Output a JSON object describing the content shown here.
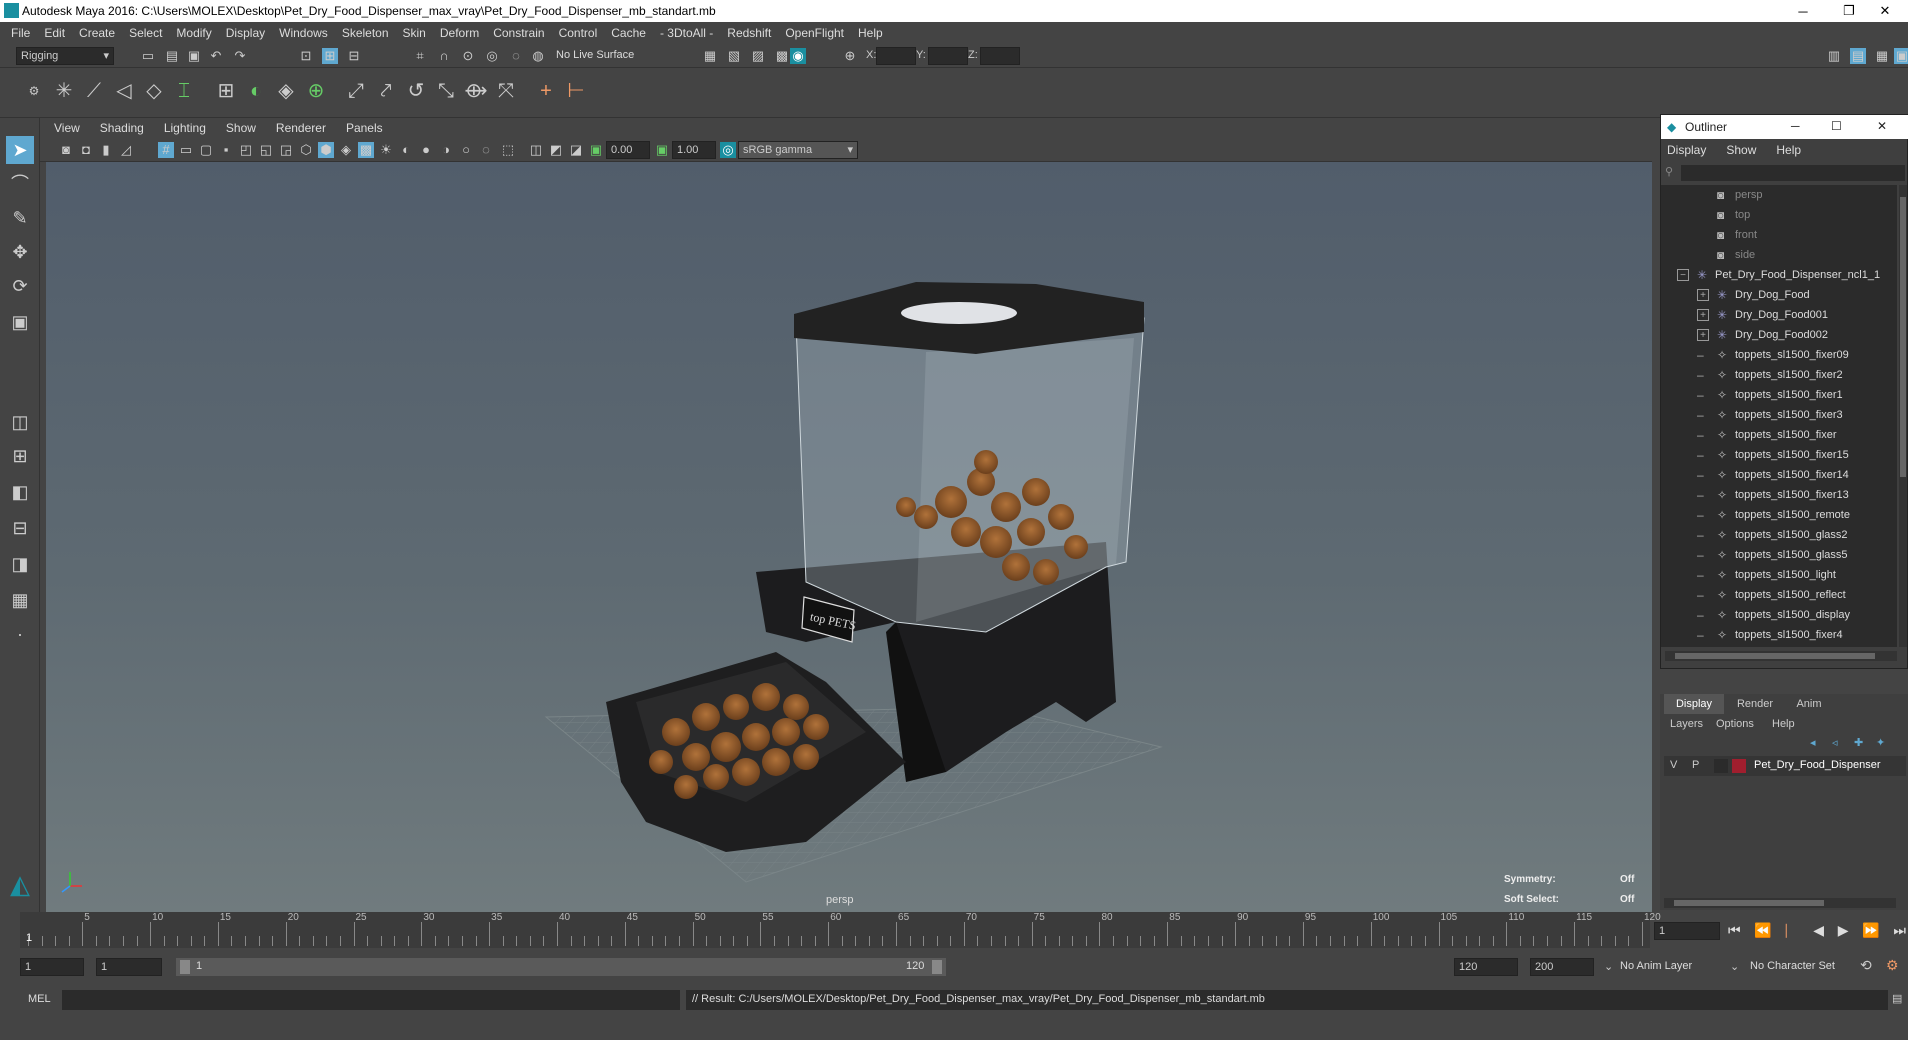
{
  "window": {
    "title": "Autodesk Maya 2016: C:\\Users\\MOLEX\\Desktop\\Pet_Dry_Food_Dispenser_max_vray\\Pet_Dry_Food_Dispenser_mb_standart.mb",
    "min": "─",
    "restore": "❐",
    "close": "✕"
  },
  "menubar": [
    "File",
    "Edit",
    "Create",
    "Select",
    "Modify",
    "Display",
    "Windows",
    "Skeleton",
    "Skin",
    "Deform",
    "Constrain",
    "Control",
    "Cache",
    "- 3DtoAll -",
    "Redshift",
    "OpenFlight",
    "Help"
  ],
  "toolbar": {
    "mode": "Rigging",
    "live_surface": "No Live Surface",
    "x_label": "X:",
    "y_label": "Y:",
    "z_label": "Z:"
  },
  "panel_menu": [
    "View",
    "Shading",
    "Lighting",
    "Show",
    "Renderer",
    "Panels"
  ],
  "viewbar": {
    "exposure": "0.00",
    "gamma": "1.00",
    "colorspace": "sRGB gamma"
  },
  "viewport": {
    "camera": "persp",
    "symmetry_label": "Symmetry:",
    "symmetry_value": "Off",
    "softselect_label": "Soft Select:",
    "softselect_value": "Off",
    "brand_text": "top PETS"
  },
  "outliner": {
    "title": "Outliner",
    "menu": [
      "Display",
      "Show",
      "Help"
    ],
    "items": [
      {
        "label": "persp",
        "type": "camera",
        "dim": true
      },
      {
        "label": "top",
        "type": "camera",
        "dim": true
      },
      {
        "label": "front",
        "type": "camera",
        "dim": true
      },
      {
        "label": "side",
        "type": "camera",
        "dim": true
      },
      {
        "label": "Pet_Dry_Food_Dispenser_ncl1_1",
        "type": "group",
        "expand": "−"
      },
      {
        "label": "Dry_Dog_Food",
        "type": "group",
        "expand": "+"
      },
      {
        "label": "Dry_Dog_Food001",
        "type": "group",
        "expand": "+"
      },
      {
        "label": "Dry_Dog_Food002",
        "type": "group",
        "expand": "+"
      },
      {
        "label": "toppets_sl1500_fixer09",
        "type": "mesh"
      },
      {
        "label": "toppets_sl1500_fixer2",
        "type": "mesh"
      },
      {
        "label": "toppets_sl1500_fixer1",
        "type": "mesh"
      },
      {
        "label": "toppets_sl1500_fixer3",
        "type": "mesh"
      },
      {
        "label": "toppets_sl1500_fixer",
        "type": "mesh"
      },
      {
        "label": "toppets_sl1500_fixer15",
        "type": "mesh"
      },
      {
        "label": "toppets_sl1500_fixer14",
        "type": "mesh"
      },
      {
        "label": "toppets_sl1500_fixer13",
        "type": "mesh"
      },
      {
        "label": "toppets_sl1500_remote",
        "type": "mesh"
      },
      {
        "label": "toppets_sl1500_glass2",
        "type": "mesh"
      },
      {
        "label": "toppets_sl1500_glass5",
        "type": "mesh"
      },
      {
        "label": "toppets_sl1500_light",
        "type": "mesh"
      },
      {
        "label": "toppets_sl1500_reflect",
        "type": "mesh"
      },
      {
        "label": "toppets_sl1500_display",
        "type": "mesh"
      },
      {
        "label": "toppets_sl1500_fixer4",
        "type": "mesh"
      }
    ]
  },
  "layers": {
    "tabs": [
      "Display",
      "Render",
      "Anim"
    ],
    "menu": [
      "Layers",
      "Options",
      "Help"
    ],
    "row": {
      "v": "V",
      "p": "P",
      "name": "Pet_Dry_Food_Dispenser",
      "color": "#a01e2e"
    }
  },
  "timeline": {
    "ticks": [
      "5",
      "10",
      "15",
      "20",
      "25",
      "30",
      "35",
      "40",
      "45",
      "50",
      "55",
      "60",
      "65",
      "70",
      "75",
      "80",
      "85",
      "90",
      "95",
      "100",
      "105",
      "110",
      "115",
      "120"
    ],
    "start_marker": "1",
    "current_frame": "1"
  },
  "range": {
    "start": "1",
    "playback_start": "1",
    "slider_start": "1",
    "slider_end": "120",
    "playback_end": "120",
    "end": "200",
    "anim_layer": "No Anim Layer",
    "char_set": "No Character Set"
  },
  "cmdline": {
    "lang": "MEL",
    "result": "// Result: C:/Users/MOLEX/Desktop/Pet_Dry_Food_Dispenser_max_vray/Pet_Dry_Food_Dispenser_mb_standart.mb"
  },
  "colors": {
    "accent": "#5fa8d0",
    "teal": "#1a8fa0",
    "layer_red": "#a01e2e"
  }
}
